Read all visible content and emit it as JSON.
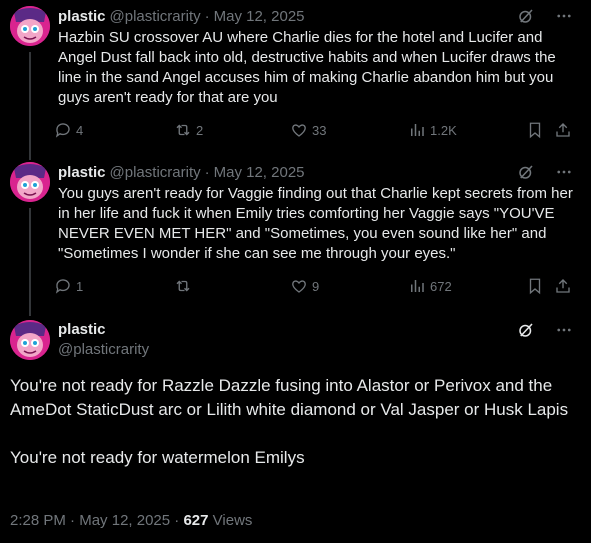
{
  "tweets": [
    {
      "name": "plastic",
      "handle": "@plasticrarity",
      "separator": "·",
      "date": "May 12, 2025",
      "text": "Hazbin SU crossover AU where Charlie dies for the hotel and Lucifer and Angel Dust fall back into old, destructive habits and when Lucifer draws the line in the sand Angel accuses him of making Charlie abandon him but you guys aren't ready for that are you",
      "replies": "4",
      "reposts": "2",
      "likes": "33",
      "views": "1.2K"
    },
    {
      "name": "plastic",
      "handle": "@plasticrarity",
      "separator": "·",
      "date": "May 12, 2025",
      "text": "You guys aren't ready for Vaggie finding out that Charlie kept secrets from her in her life and fuck it when Emily tries comforting her Vaggie says \"YOU'VE NEVER EVEN MET HER\" and \"Sometimes, you even sound like her\" and \"Sometimes I wonder if she can see me through your eyes.\"",
      "replies": "1",
      "reposts": "",
      "likes": "9",
      "views": "672"
    }
  ],
  "main": {
    "name": "plastic",
    "handle": "@plasticrarity",
    "paragraph1": "You're not ready for Razzle Dazzle fusing into Alastor or Perivox and the AmeDot StaticDust arc or Lilith white diamond or Val Jasper or Husk Lapis",
    "paragraph2": "You're not ready for watermelon Emilys",
    "time": "2:28 PM",
    "separator": "·",
    "date": "May 12, 2025",
    "separator2": "·",
    "views_count": "627",
    "views_label": "Views"
  },
  "colors": {
    "background": "#000000",
    "text": "#e7e9ea",
    "muted": "#71767b",
    "thread_line": "#333639",
    "avatar": "#d9248f"
  }
}
